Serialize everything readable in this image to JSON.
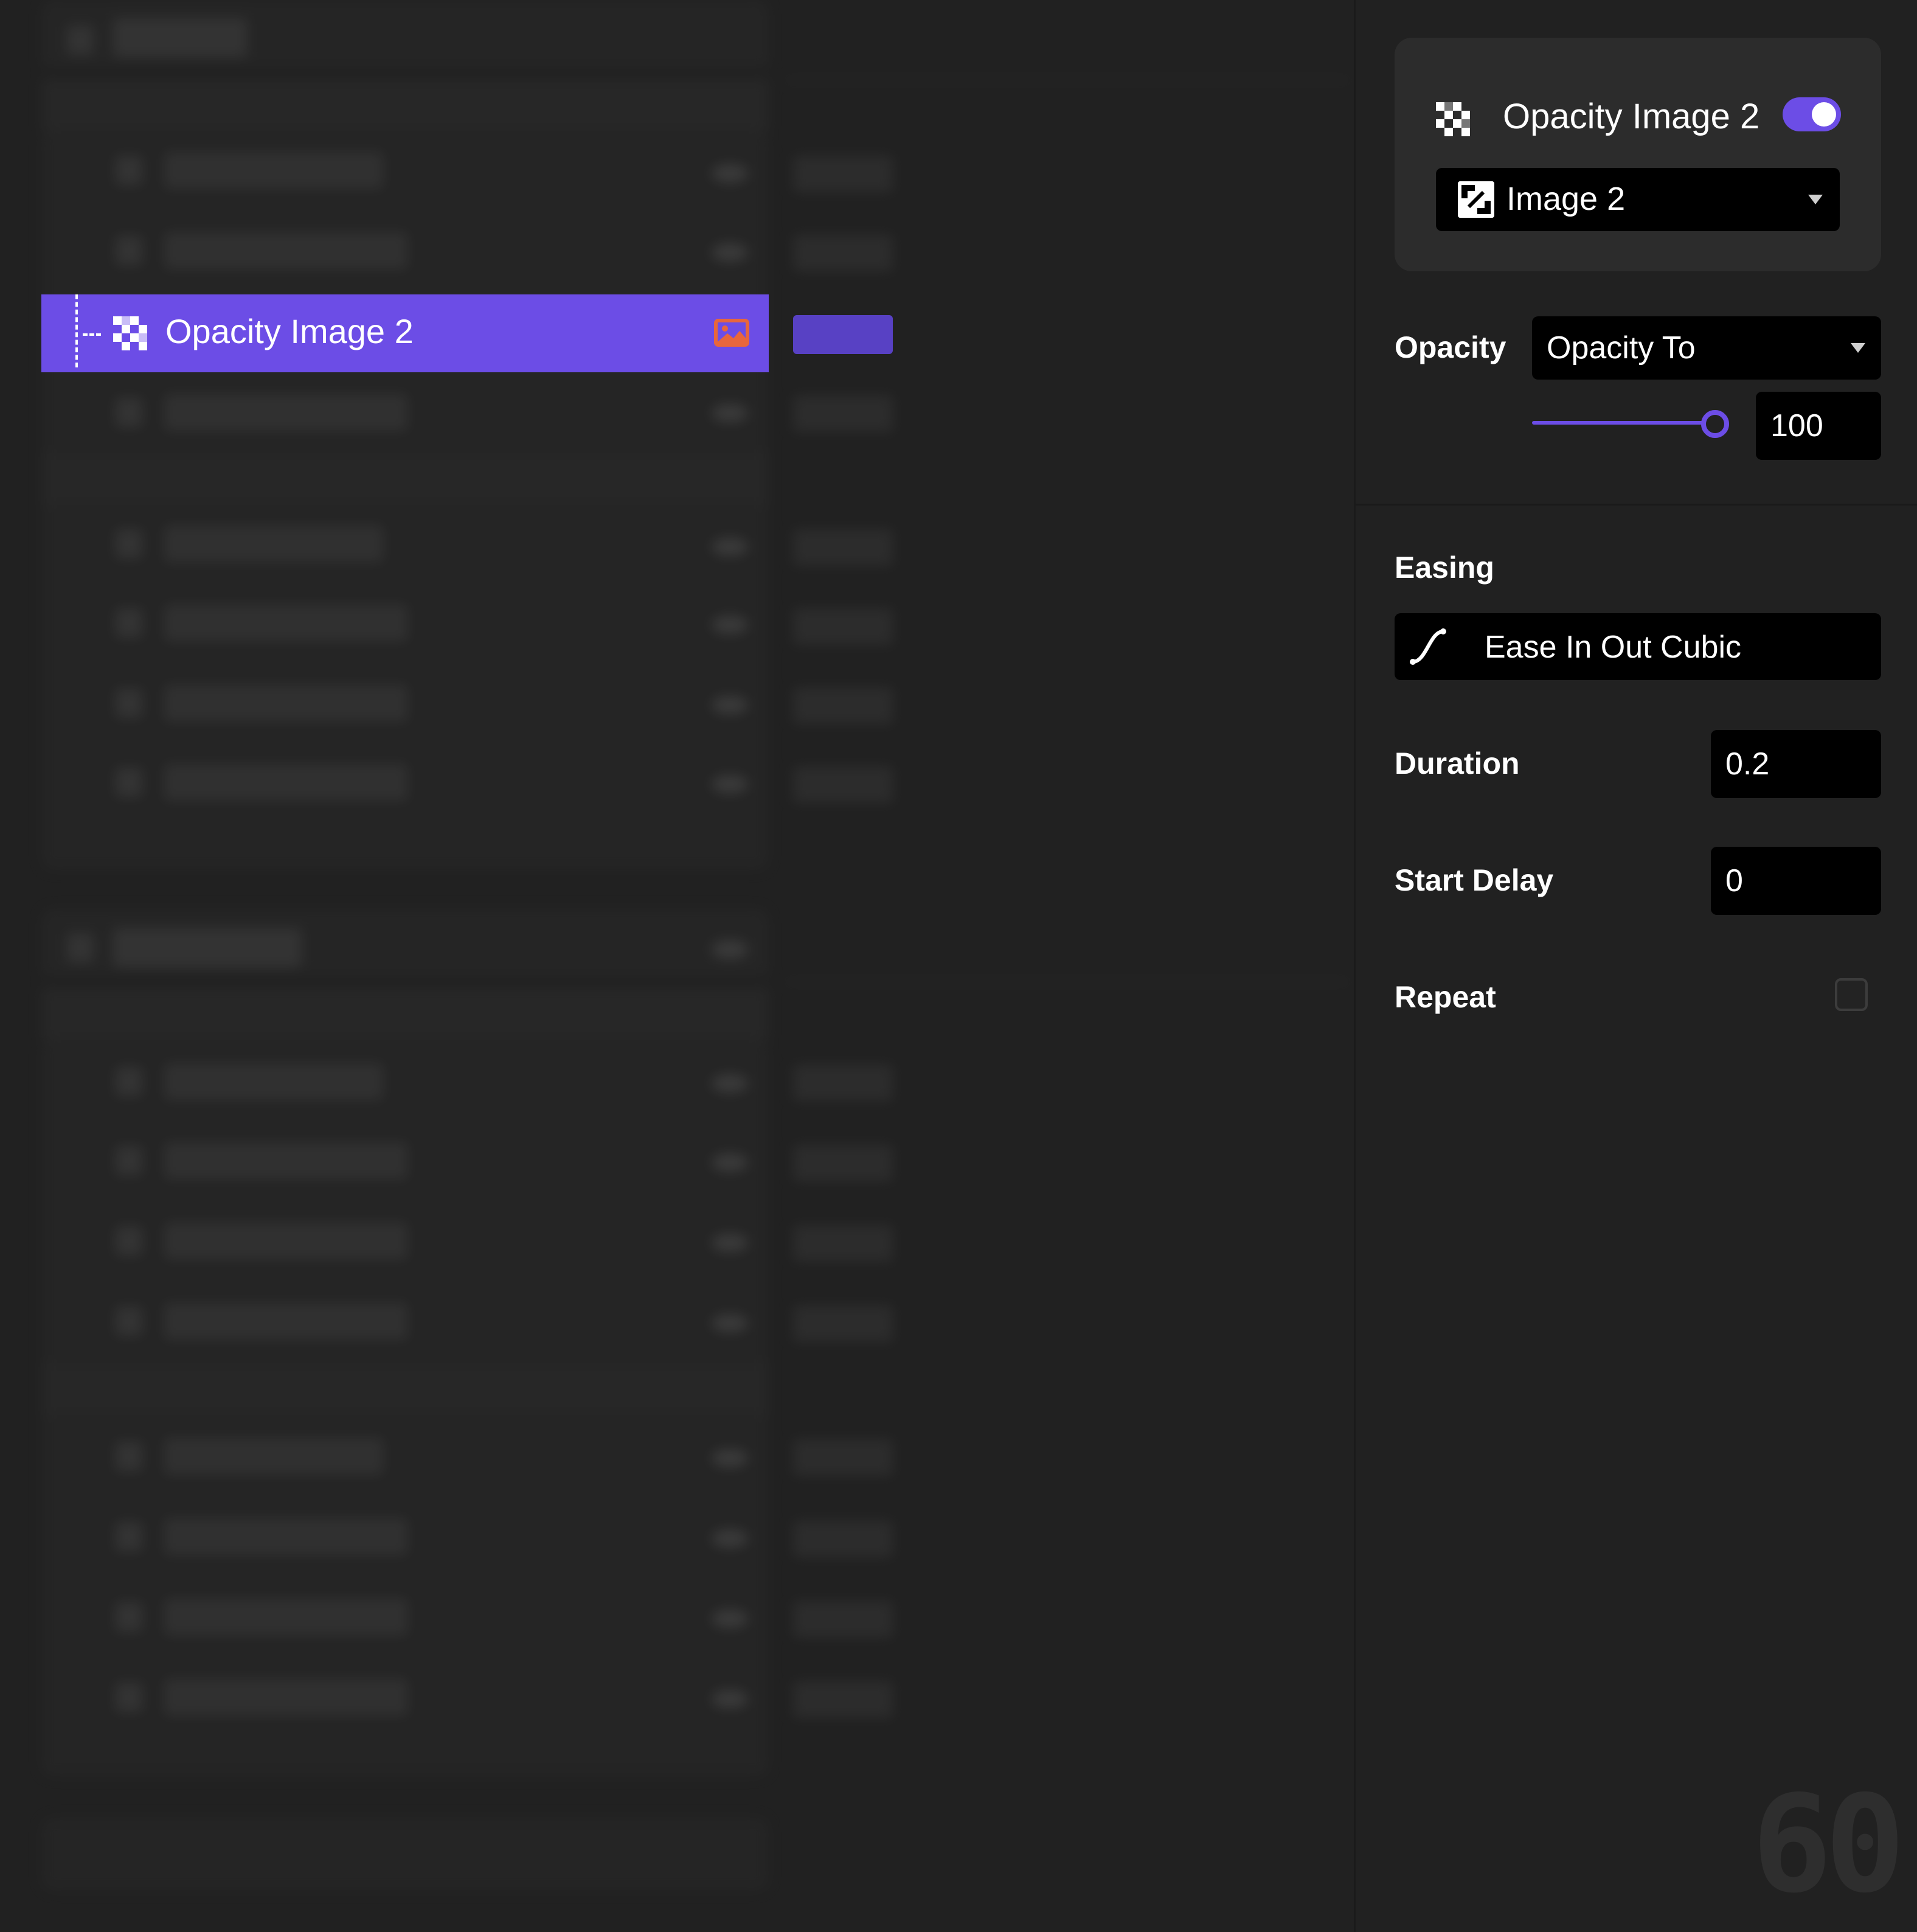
{
  "timeline": {
    "selected_item": {
      "label": "Opacity Image 2"
    }
  },
  "inspector": {
    "card": {
      "title": "Opacity Image 2",
      "enabled": true,
      "target_select_value": "Image 2"
    },
    "opacity": {
      "label": "Opacity",
      "mode_select_value": "Opacity To",
      "slider_value": 100,
      "value": "100"
    },
    "easing": {
      "label": "Easing",
      "select_value": "Ease In Out Cubic"
    },
    "duration": {
      "label": "Duration",
      "value": "0.2"
    },
    "start_delay": {
      "label": "Start Delay",
      "value": "0"
    },
    "repeat": {
      "label": "Repeat",
      "checked": false
    }
  },
  "fps_counter": "60",
  "colors": {
    "accent": "#6c4de6",
    "background": "#212121",
    "field": "#000000",
    "image_icon": "#e8663c"
  }
}
